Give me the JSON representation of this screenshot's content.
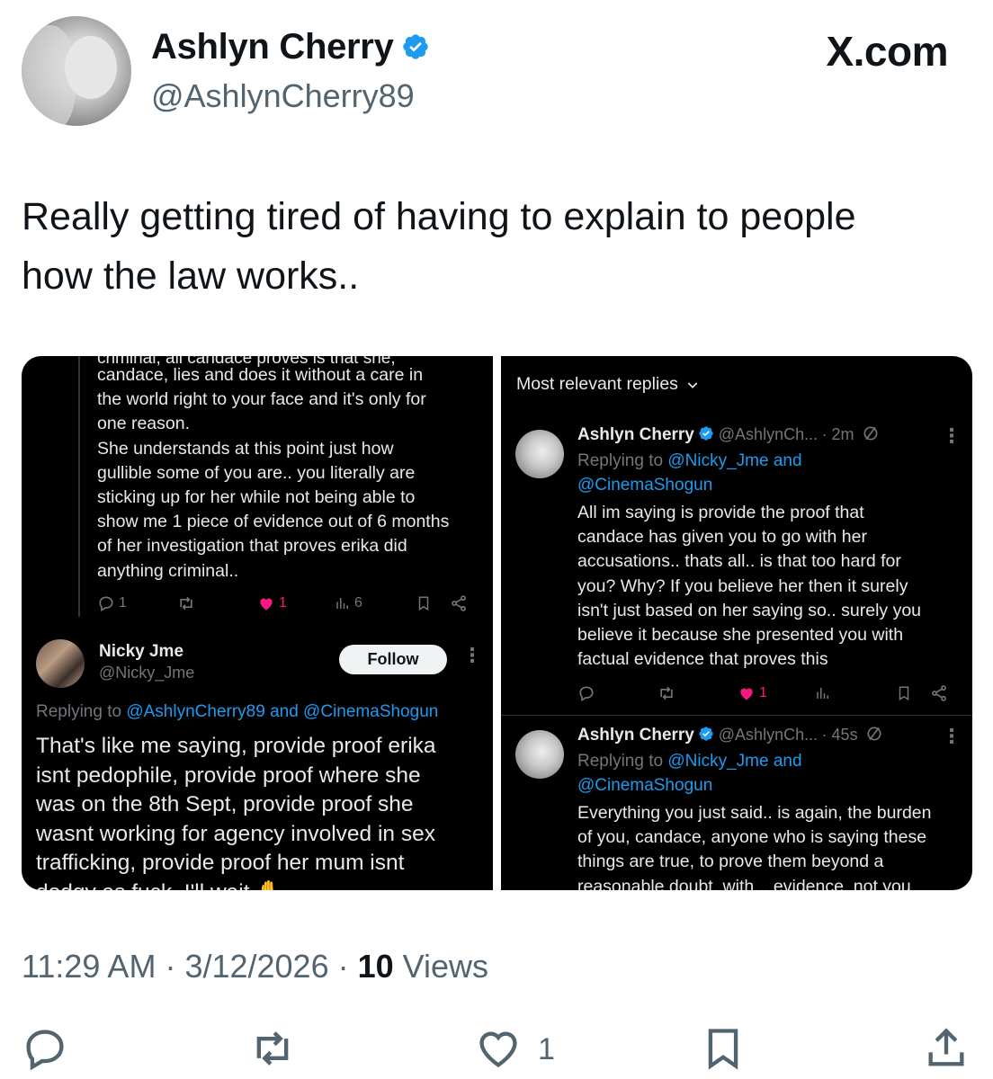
{
  "header": {
    "display_name": "Ashlyn Cherry",
    "handle": "@AshlynCherry89",
    "brand": "X.com"
  },
  "tweet": {
    "text_line1": "Really getting tired of having to explain to people",
    "text_line2": "how the law works.."
  },
  "left_panel": {
    "cut_text": "criminal, all candace proves is that she,",
    "body_lines": [
      "candace, lies and does it without a care in",
      "the world right to your face and it's only for",
      "one reason.",
      "She understands at this point just how",
      "gullible some of you are.. you literally are",
      "sticking up for her while not being able to",
      "show me 1 piece of evidence out of 6 months",
      "of her investigation that proves erika did",
      "anything criminal.."
    ],
    "actions": {
      "replies": "1",
      "likes": "1",
      "views": "6"
    },
    "reply": {
      "name": "Nicky Jme",
      "handle": "@Nicky_Jme",
      "follow_label": "Follow",
      "replying_prefix": "Replying to ",
      "replying_mentions": "@AshlynCherry89 and @CinemaShogun",
      "body_lines": [
        "That's like me saying, provide proof erika",
        "isnt pedophile,  provide proof where she",
        "was on the 8th Sept,  provide proof she",
        "wasnt working for agency involved in sex",
        "trafficking, provide proof her mum isnt",
        "dodgy as fuck. I'll wait ✋"
      ]
    }
  },
  "right_panel": {
    "sort_label": "Most relevant replies",
    "replies": [
      {
        "name": "Ashlyn Cherry",
        "handle": "@AshlynCh...",
        "time": "· 2m",
        "replying_prefix": "Replying to ",
        "replying_line1": "@Nicky_Jme and",
        "replying_line2": "@CinemaShogun",
        "body_lines": [
          "All im saying is provide the proof that",
          "candace has given you to go with her",
          "accusations.. thats all.. is that too hard for",
          "you? Why? If you believe her then it surely",
          "isn't just based on her saying so.. surely you",
          "believe it because she presented you with",
          "factual evidence that proves this"
        ],
        "likes": "1"
      },
      {
        "name": "Ashlyn Cherry",
        "handle": "@AshlynCh...",
        "time": "· 45s",
        "replying_prefix": "Replying to ",
        "replying_line1": "@Nicky_Jme and",
        "replying_line2": "@CinemaShogun",
        "body_lines": [
          "Everything you just said.. is again, the burden",
          "of you, candace, anyone who is saying these",
          "things are true, to prove them beyond a",
          "reasonable doubt,  with... evidence,  not you"
        ]
      }
    ]
  },
  "footer": {
    "time": "11:29 AM",
    "sep1": " · ",
    "date": "3/12/2026",
    "sep2": " · ",
    "views_count": "10",
    "views_label": " Views",
    "like_count": "1"
  },
  "colors": {
    "verified_blue": "#1d9bf0",
    "like_pink": "#f91880",
    "muted_gray": "#536471"
  },
  "icons": [
    "verified-badge-icon",
    "reply-icon",
    "repost-icon",
    "like-icon",
    "views-icon",
    "bookmark-icon",
    "share-icon",
    "chevron-down-icon",
    "grok-icon",
    "more-icon"
  ]
}
